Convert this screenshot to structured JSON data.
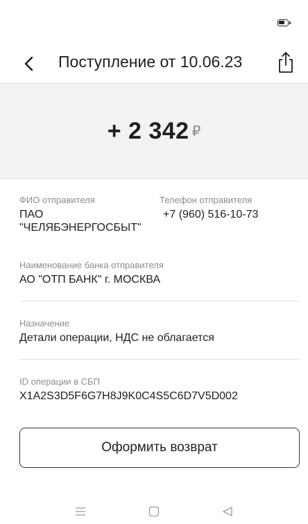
{
  "header": {
    "title": "Поступление от 10.06.23"
  },
  "amount": {
    "value": "+ 2 342",
    "currency_symbol": "₽"
  },
  "details": {
    "sender_name": {
      "label": "ФИО отправителя",
      "value_line1": "ПАО",
      "value_line2": "\"ЧЕЛЯБЭНЕРГОСБЫТ\""
    },
    "sender_phone": {
      "label": "Телефон отправителя",
      "value": "+7 (960) 516-10-73"
    },
    "sender_bank": {
      "label": "Наименование банка отправителя",
      "value": "АО \"ОТП БАНК\" г. МОСКВА"
    },
    "purpose": {
      "label": "Назначение",
      "value": "Детали операции, НДС не облагается"
    },
    "sbp_operation_id": {
      "label": "ID операции в СБП",
      "value": "X1A2S3D5F6G7H8J9K0C4S5C6D7V5D002"
    }
  },
  "refund_button_label": "Оформить возврат",
  "icons": {
    "back": "chevron-left-icon",
    "share": "share-icon",
    "battery": "battery-icon",
    "nav_menu": "menu-icon",
    "nav_home": "home-square-icon",
    "nav_back": "back-triangle-icon"
  },
  "colors": {
    "amount_panel_bg": "#f3f3f5",
    "label_gray": "#8c8c8c",
    "text_dark": "#1f1f1f",
    "divider": "#e2e2e2"
  }
}
